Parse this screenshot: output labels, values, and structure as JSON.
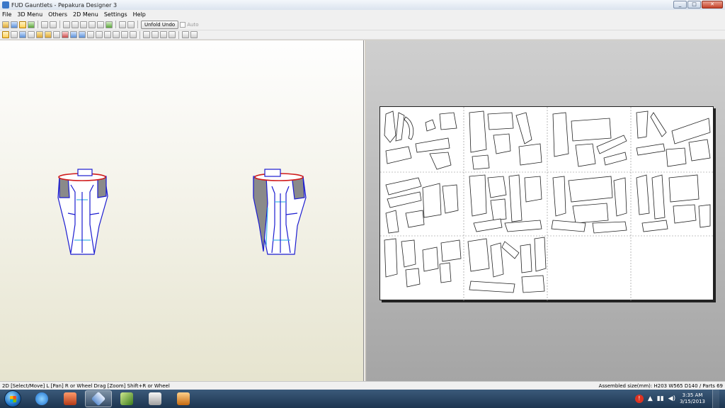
{
  "window": {
    "title": "FUD Gauntlets - Pepakura Designer 3",
    "minimize": "_",
    "maximize": "□",
    "close": "✕"
  },
  "menu": {
    "items": [
      "File",
      "3D Menu",
      "Others",
      "2D Menu",
      "Settings",
      "Help"
    ]
  },
  "toolbar": {
    "unfold_undo_label": "Unfold Undo",
    "auto_label": "Auto"
  },
  "status": {
    "hint": "2D [Select/Move] L [Pan] R or Wheel Drag [Zoom] Shift+R or Wheel",
    "assembled": "Assembled size(mm): H203 W565 D140 / Parts 69"
  },
  "taskbar": {
    "time": "3:35 AM",
    "date": "3/15/2013",
    "apps": [
      "ie-icon",
      "app-icon",
      "pepakura-icon",
      "bamboo-icon",
      "media-icon",
      "package-icon"
    ]
  },
  "colors": {
    "model_outline": "#1b1bd0",
    "model_fold": "#3fb4e6",
    "model_cut": "#d01b1b",
    "model_fill": "#ffffff",
    "model_shade": "#8a8a8a"
  }
}
